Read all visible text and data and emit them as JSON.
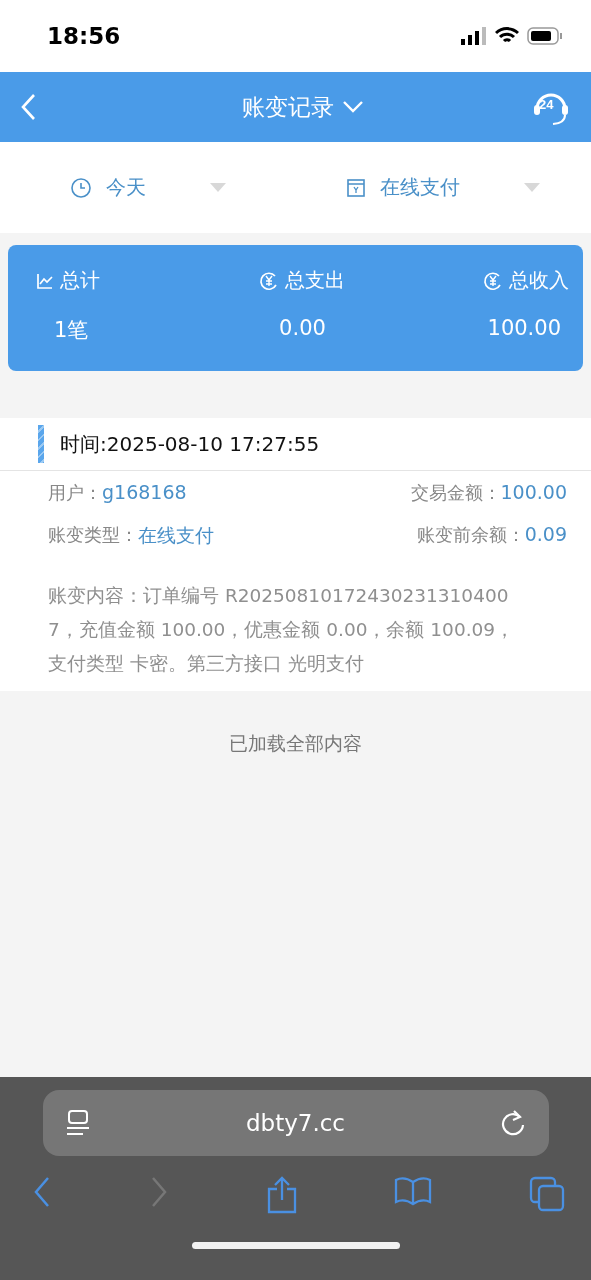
{
  "status_bar": {
    "time": "18:56"
  },
  "nav": {
    "title": "账变记录",
    "support_badge": "24"
  },
  "filters": [
    {
      "kind": "time",
      "label": "今天"
    },
    {
      "kind": "type",
      "label": "在线支付"
    }
  ],
  "summary": [
    {
      "kind": "chart",
      "label": "总计",
      "value": "1笔"
    },
    {
      "kind": "money",
      "label": "总支出",
      "value": "0.00"
    },
    {
      "kind": "money",
      "label": "总收入",
      "value": "100.00"
    }
  ],
  "record": {
    "time": "时间:2025-08-10 17:27:55",
    "fields": [
      {
        "label": "用户：",
        "value": "g168168"
      },
      {
        "label": "交易金额：",
        "value": "100.00"
      },
      {
        "label": "账变类型：",
        "value": "在线支付"
      },
      {
        "label": "账变前余额：",
        "value": "0.09"
      }
    ],
    "content": "账变内容：订单编号 R202508101724302313104007，充值金额 100.00，优惠金额 0.00，余额 100.09，支付类型 卡密。第三方接口 光明支付"
  },
  "footer_note": "已加载全部内容",
  "browser": {
    "url": "dbty7.cc",
    "toolbar": [
      {
        "kind": "back",
        "disabled": false
      },
      {
        "kind": "forward",
        "disabled": true
      },
      {
        "kind": "share",
        "disabled": false
      },
      {
        "kind": "bookmarks",
        "disabled": false
      },
      {
        "kind": "tabs",
        "disabled": false
      }
    ]
  }
}
